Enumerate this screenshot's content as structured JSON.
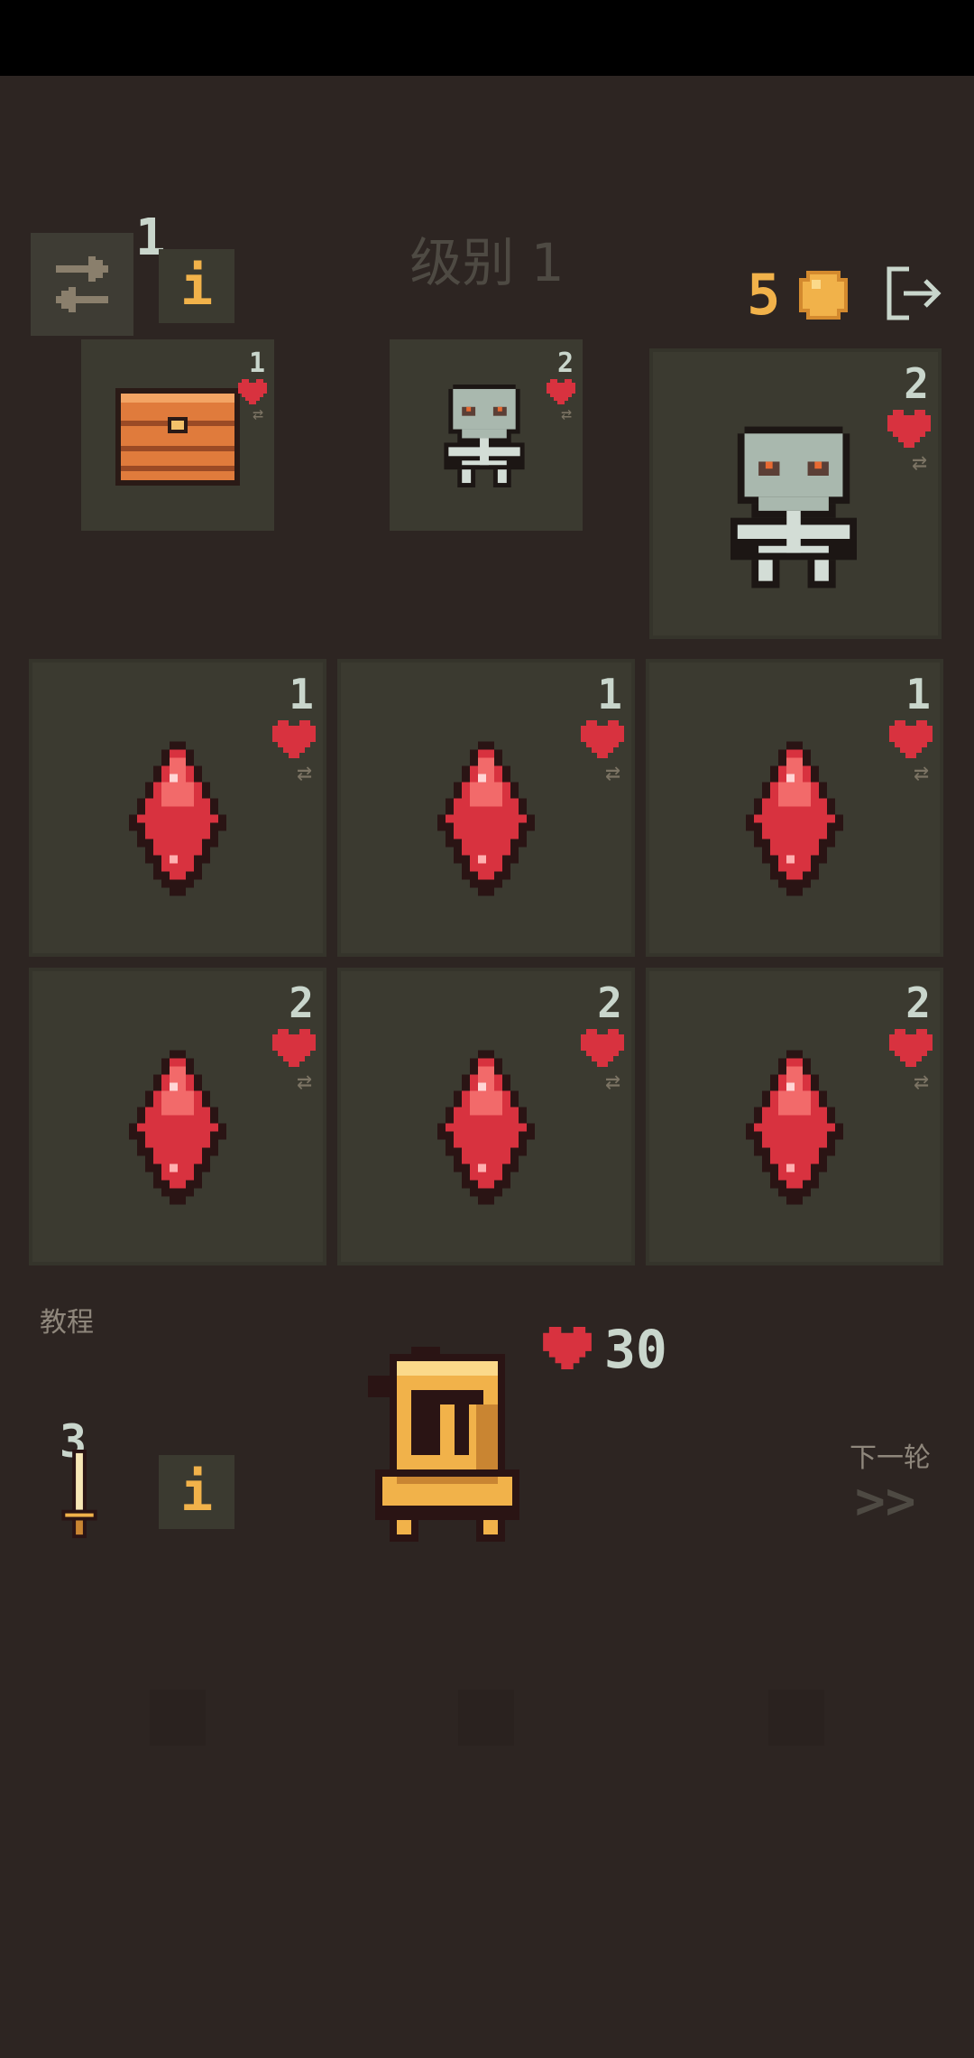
{
  "header": {
    "level_title": "级别 1",
    "reroll_count": "1",
    "info_label": "i",
    "gold": "5"
  },
  "enemies": [
    {
      "name": "chest",
      "value": "1"
    },
    {
      "name": "skeleton",
      "value": "2"
    },
    {
      "name": "skeleton",
      "value": "2"
    }
  ],
  "grid": [
    {
      "item": "ruby",
      "value": "1"
    },
    {
      "item": "ruby",
      "value": "1"
    },
    {
      "item": "ruby",
      "value": "1"
    },
    {
      "item": "ruby",
      "value": "2"
    },
    {
      "item": "ruby",
      "value": "2"
    },
    {
      "item": "ruby",
      "value": "2"
    }
  ],
  "player": {
    "tutorial_label": "教程",
    "hp": "30",
    "weapon_value": "3",
    "info_label": "i",
    "next_round_label": "下一轮",
    "next_round_icon": ">>"
  },
  "colors": {
    "background": "#2d2522",
    "panel": "#3b3a30",
    "heart": "#d8323f",
    "gold": "#f1b24a",
    "text": "#c9d6cc"
  }
}
